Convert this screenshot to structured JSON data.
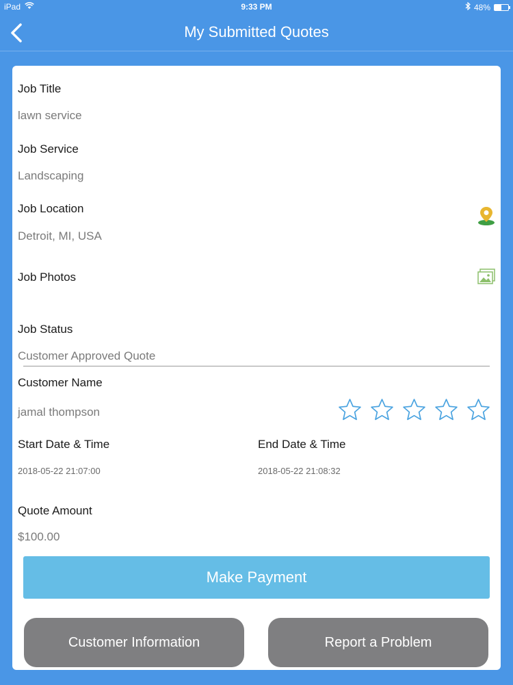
{
  "status_bar": {
    "device": "iPad",
    "time": "9:33 PM",
    "battery": "48%",
    "battery_level": 0.48,
    "icons": [
      "wifi-icon",
      "bluetooth-icon",
      "battery-icon"
    ]
  },
  "nav": {
    "title": "My Submitted Quotes",
    "back_icon": "chevron-left-icon"
  },
  "job": {
    "title_label": "Job Title",
    "title_value": "lawn service",
    "service_label": "Job Service",
    "service_value": "Landscaping",
    "location_label": "Job Location",
    "location_value": "Detroit, MI, USA",
    "location_icon": "map-pin-icon",
    "photos_label": "Job Photos",
    "photos_icon": "photo-gallery-icon",
    "status_label": "Job Status",
    "status_value": "Customer Approved Quote",
    "customer_label": "Customer Name",
    "customer_value": "jamal thompson",
    "rating": {
      "filled": 0,
      "max": 5,
      "icon": "star-outline-icon"
    },
    "start_label": "Start Date & Time",
    "start_value": "2018-05-22 21:07:00",
    "end_label": "End Date & Time",
    "end_value": "2018-05-22 21:08:32",
    "amount_label": "Quote Amount",
    "amount_value": "$100.00"
  },
  "actions": {
    "pay_label": "Make Payment",
    "customer_info_label": "Customer Information",
    "report_label": "Report a Problem"
  },
  "colors": {
    "background": "#4a96e6",
    "pay_button": "#65bde6",
    "secondary_button": "#7f7f81",
    "star_outline": "#4aa3e0",
    "map_pin": "#e0b030"
  }
}
